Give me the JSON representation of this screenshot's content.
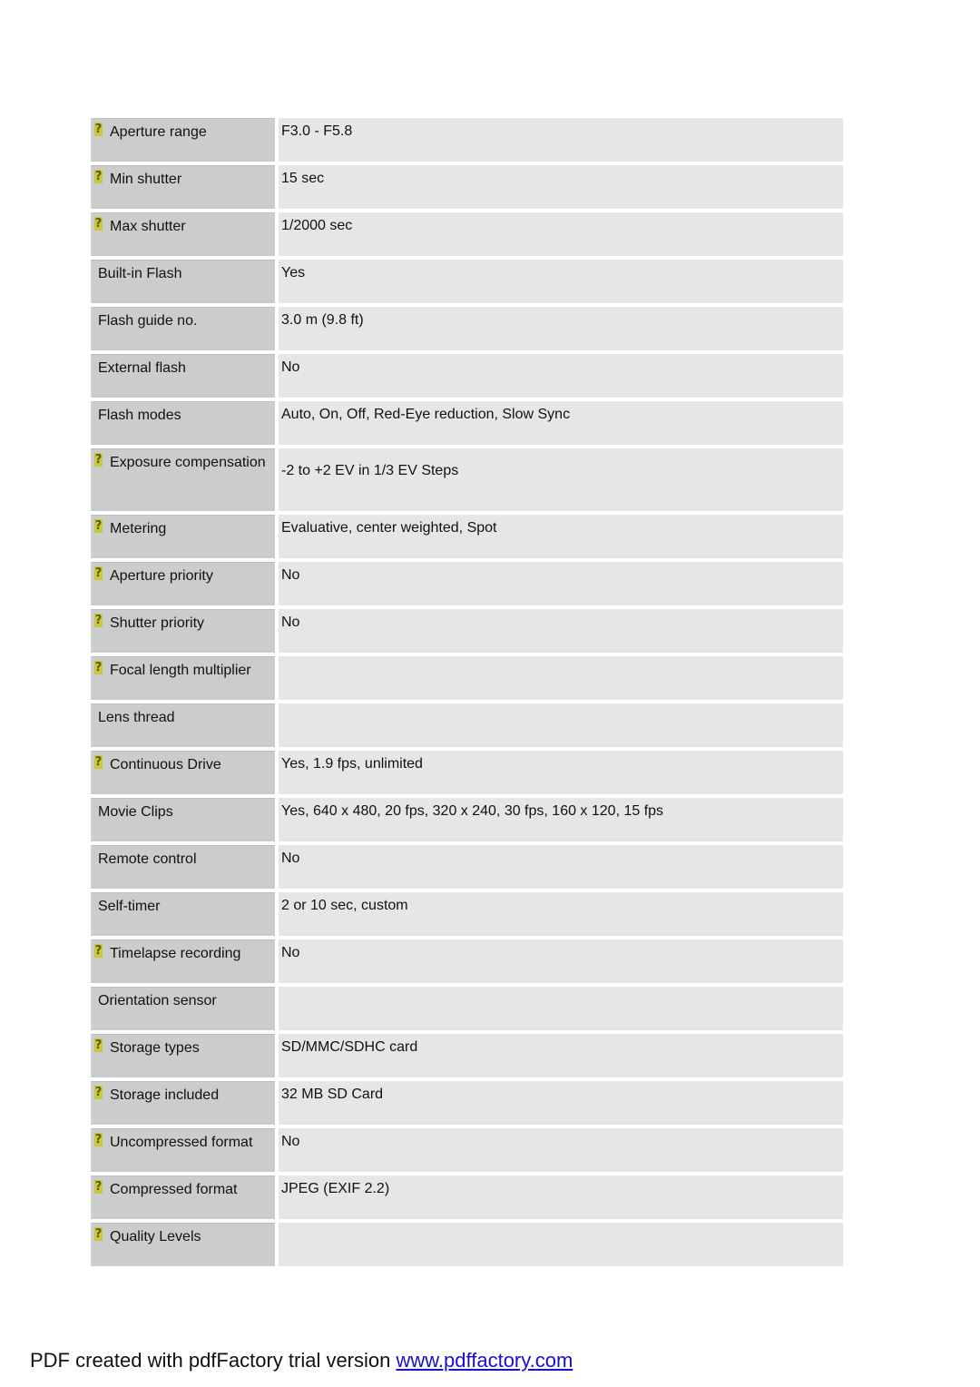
{
  "specs": [
    {
      "label": "Aperture range",
      "value": "F3.0 - F5.8",
      "help": true
    },
    {
      "label": "Min shutter",
      "value": "15 sec",
      "help": true
    },
    {
      "label": "Max shutter",
      "value": "1/2000 sec",
      "help": true
    },
    {
      "label": "Built-in Flash",
      "value": "Yes",
      "help": false
    },
    {
      "label": "Flash guide no.",
      "value": "3.0 m (9.8 ft)",
      "help": false
    },
    {
      "label": "External flash",
      "value": "No",
      "help": false
    },
    {
      "label": "Flash modes",
      "value": "Auto, On, Off, Red-Eye reduction, Slow Sync",
      "help": false
    },
    {
      "label": "Exposure compensation",
      "value": "-2 to +2 EV in 1/3 EV Steps",
      "help": true
    },
    {
      "label": "Metering",
      "value": "Evaluative, center weighted, Spot",
      "help": true
    },
    {
      "label": "Aperture priority",
      "value": "No",
      "help": true
    },
    {
      "label": "Shutter priority",
      "value": "No",
      "help": true
    },
    {
      "label": "Focal length multiplier",
      "value": "",
      "help": true
    },
    {
      "label": "Lens thread",
      "value": "",
      "help": false
    },
    {
      "label": "Continuous Drive",
      "value": "Yes, 1.9 fps, unlimited",
      "help": true
    },
    {
      "label": "Movie Clips",
      "value": "Yes, 640 x 480, 20 fps, 320 x 240, 30 fps, 160 x 120, 15 fps",
      "help": false
    },
    {
      "label": "Remote control",
      "value": "No",
      "help": false
    },
    {
      "label": "Self-timer",
      "value": "2 or 10 sec, custom",
      "help": false
    },
    {
      "label": "Timelapse recording",
      "value": "No",
      "help": true
    },
    {
      "label": "Orientation sensor",
      "value": "",
      "help": false
    },
    {
      "label": "Storage types",
      "value": "SD/MMC/SDHC card",
      "help": true
    },
    {
      "label": "Storage included",
      "value": "32 MB SD Card",
      "help": true
    },
    {
      "label": "Uncompressed format",
      "value": "No",
      "help": true
    },
    {
      "label": "Compressed format",
      "value": "JPEG (EXIF 2.2)",
      "help": true
    },
    {
      "label": "Quality Levels",
      "value": "",
      "help": true
    }
  ],
  "help_icon": {
    "glyph": "?",
    "name": "help-icon",
    "color": "#c8c83a"
  },
  "colors": {
    "label_bg": "#cccccc",
    "value_bg": "#e6e6e6",
    "link": "#1a0dcc"
  },
  "footer": {
    "text": "PDF created with pdfFactory trial version ",
    "link_text": "www.pdffactory.com"
  }
}
